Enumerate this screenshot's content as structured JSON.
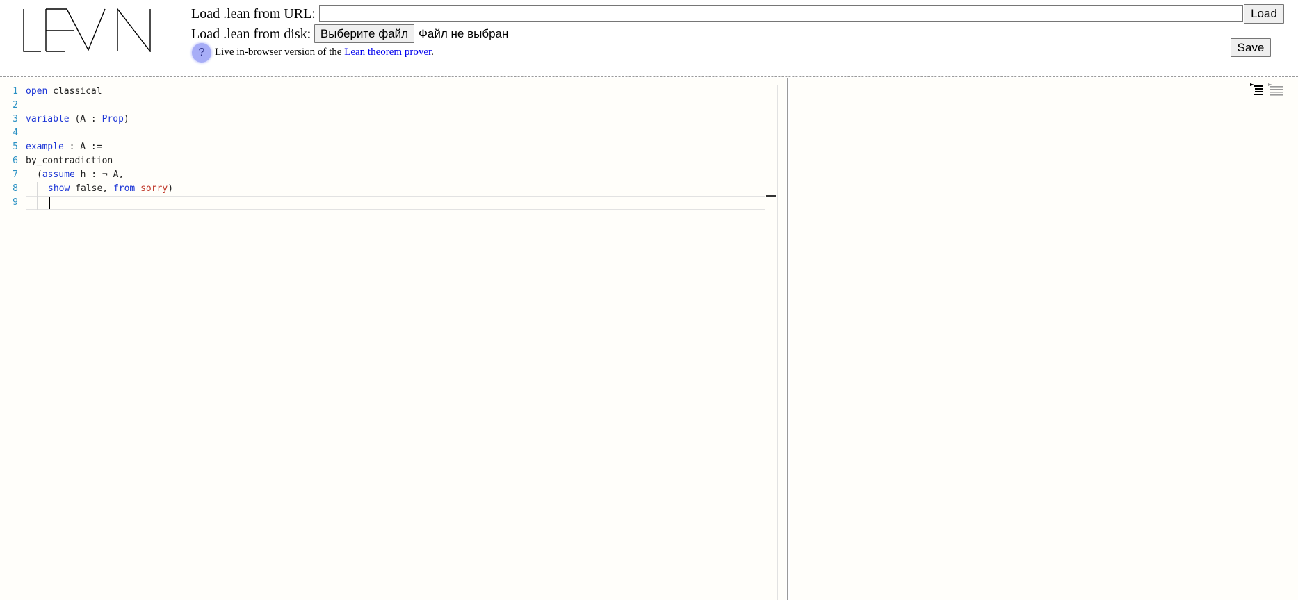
{
  "header": {
    "url_label": "Load .lean from URL:",
    "url_value": "",
    "load_button": "Load",
    "disk_label": "Load .lean from disk:",
    "file_button": "Выберите файл",
    "file_status": "Файл не выбран",
    "save_button": "Save",
    "help_badge": "?",
    "help_prefix": "Live in-browser version of the ",
    "help_link": "Lean theorem prover",
    "help_suffix": "."
  },
  "editor": {
    "line_numbers": [
      "1",
      "2",
      "3",
      "4",
      "5",
      "6",
      "7",
      "8",
      "9"
    ],
    "lines": [
      [
        {
          "t": "open",
          "k": "kw"
        },
        {
          "t": " classical",
          "k": ""
        }
      ],
      [],
      [
        {
          "t": "variable",
          "k": "kw"
        },
        {
          "t": " (A : ",
          "k": ""
        },
        {
          "t": "Prop",
          "k": "kw"
        },
        {
          "t": ")",
          "k": ""
        }
      ],
      [],
      [
        {
          "t": "example",
          "k": "kw"
        },
        {
          "t": " : A :=",
          "k": ""
        }
      ],
      [
        {
          "t": "by_contradiction",
          "k": ""
        }
      ],
      [
        {
          "t": "(",
          "k": "",
          "indent": 1
        },
        {
          "t": "assume",
          "k": "kw"
        },
        {
          "t": " h : ¬ A,",
          "k": ""
        }
      ],
      [
        {
          "t": "show",
          "k": "kw",
          "indent": 2
        },
        {
          "t": " false, ",
          "k": ""
        },
        {
          "t": "from",
          "k": "kw"
        },
        {
          "t": " ",
          "k": ""
        },
        {
          "t": "sorry",
          "k": "err"
        },
        {
          "t": ")",
          "k": ""
        }
      ],
      [
        {
          "t": "",
          "k": "",
          "indent": 2
        }
      ]
    ]
  },
  "info_panel": {
    "tool_icons": [
      "goal-list-icon",
      "all-messages-icon"
    ]
  }
}
